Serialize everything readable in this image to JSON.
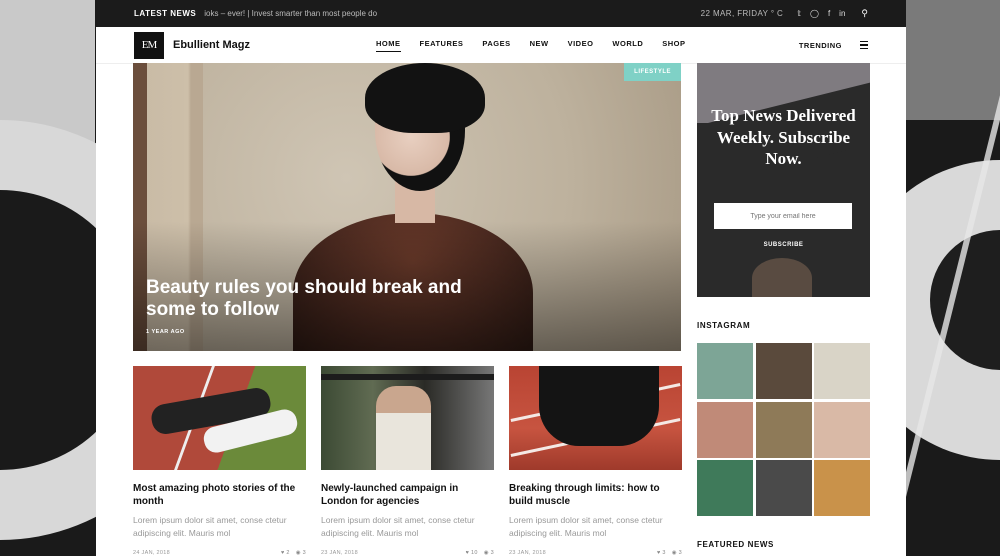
{
  "topbar": {
    "latest_label": "LATEST NEWS",
    "ticker": "ioks – ever!  |  Invest smarter than most people do",
    "date": "22 MAR, FRIDAY ° C",
    "social_icons": [
      "twitter-icon",
      "instagram-icon",
      "facebook-icon",
      "linkedin-icon"
    ]
  },
  "header": {
    "logo": "EM",
    "brand": "Ebullient Magz",
    "nav": [
      "HOME",
      "FEATURES",
      "PAGES",
      "NEW",
      "VIDEO",
      "WORLD",
      "SHOP"
    ],
    "active_nav": "HOME",
    "trending": "TRENDING"
  },
  "hero": {
    "badge": "LIFESTYLE",
    "title": "Beauty rules you should break and some to follow",
    "time": "1 YEAR AGO"
  },
  "cards": [
    {
      "title": "Most amazing photo stories of the month",
      "excerpt": "Lorem ipsum dolor sit amet, conse ctetur adipiscing elit. Mauris mol",
      "date": "24 JAN, 2018",
      "likes": "2",
      "comments": "3"
    },
    {
      "title": "Newly-launched campaign in London for agencies",
      "excerpt": "Lorem ipsum dolor sit amet, conse ctetur adipiscing elit. Mauris mol",
      "date": "23 JAN, 2018",
      "likes": "10",
      "comments": "3"
    },
    {
      "title": "Breaking through limits: how to build muscle",
      "excerpt": "Lorem ipsum dolor sit amet, conse ctetur adipiscing elit. Mauris mol",
      "date": "23 JAN, 2018",
      "likes": "3",
      "comments": "3"
    }
  ],
  "subscribe": {
    "headline": "Top News Delivered Weekly. Subscribe Now.",
    "placeholder": "Type your email here",
    "button": "SUBSCRIBE"
  },
  "sidebar": {
    "instagram_title": "INSTAGRAM",
    "featured_title": "FEATURED NEWS"
  },
  "instagram_colors": [
    "#7da596",
    "#5a4a3c",
    "#d9d4c7",
    "#c08a78",
    "#8e7a58",
    "#d9b9a6",
    "#3f7a5a",
    "#4a4a4a",
    "#c9924a"
  ]
}
